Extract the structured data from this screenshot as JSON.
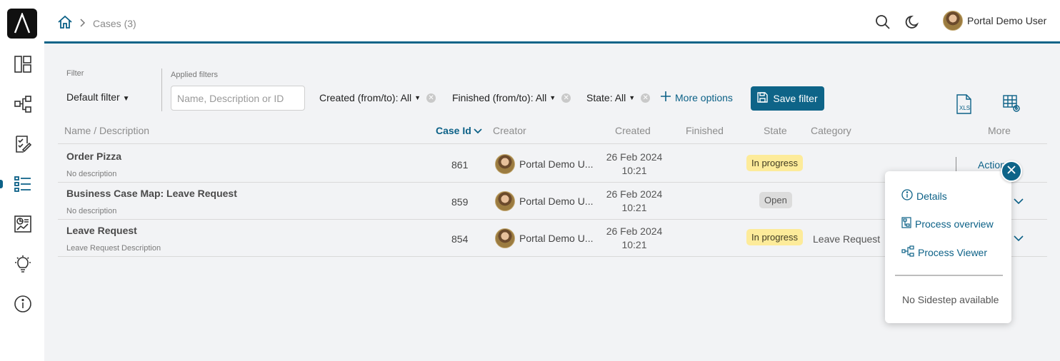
{
  "breadcrumb": {
    "current": "Cases (3)"
  },
  "user": {
    "name": "Portal Demo User"
  },
  "filter": {
    "filter_label": "Filter",
    "default_filter": "Default filter",
    "applied_label": "Applied filters",
    "search_placeholder": "Name, Description or ID",
    "search_value": "",
    "chips": {
      "created": "Created (from/to): All",
      "finished": "Finished (from/to): All",
      "state": "State: All"
    },
    "more_options": "More options",
    "save_filter": "Save filter"
  },
  "columns": {
    "name": "Name / Description",
    "case_id": "Case Id",
    "creator": "Creator",
    "created": "Created",
    "finished": "Finished",
    "state": "State",
    "category": "Category",
    "more": "More"
  },
  "rows": [
    {
      "name": "Order Pizza",
      "description": "No description",
      "id": "861",
      "creator": "Portal Demo U...",
      "created_date": "26 Feb 2024",
      "created_time": "10:21",
      "state": "In progress",
      "category": ""
    },
    {
      "name": "Business Case Map: Leave Request",
      "description": "No description",
      "id": "859",
      "creator": "Portal Demo U...",
      "created_date": "26 Feb 2024",
      "created_time": "10:21",
      "state": "Open",
      "category": ""
    },
    {
      "name": "Leave Request",
      "description": "Leave Request Description",
      "id": "854",
      "creator": "Portal Demo U...",
      "created_date": "26 Feb 2024",
      "created_time": "10:21",
      "state": "In progress",
      "category": "Leave Request"
    }
  ],
  "actions_label": "Actions",
  "popup": {
    "details": "Details",
    "process_overview": "Process overview",
    "process_viewer": "Process Viewer",
    "no_sidestep": "No Sidestep available"
  },
  "icons": {
    "sidebar": [
      "dashboard-icon",
      "process-icon",
      "tasks-icon",
      "cases-icon",
      "statistics-icon",
      "idea-icon",
      "info-icon"
    ],
    "top": [
      "home-icon",
      "search-icon",
      "dark-mode-icon"
    ],
    "tools": [
      "excel-export-icon",
      "column-config-icon"
    ]
  },
  "colors": {
    "primary": "#0e6488",
    "in_progress": "#fdeb9a",
    "open": "#dcdcdc"
  }
}
